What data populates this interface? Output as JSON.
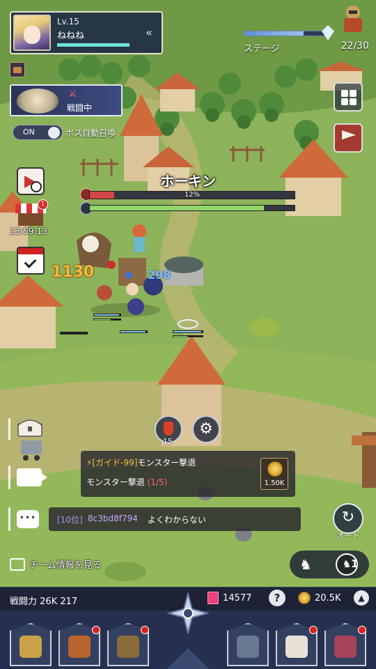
{
  "profile": {
    "level": "Lv.15",
    "name": "ねねね",
    "xp_fraction": 0.88
  },
  "battle": {
    "status": "戦闘中",
    "auto_summon_toggle": "ON",
    "auto_summon_label": "ボス自動召喚"
  },
  "shop": {
    "badge": "1",
    "timer": "23:59:13"
  },
  "stage": {
    "label": "ステージ",
    "count": "22/30",
    "progress_fraction": 0.73
  },
  "boss": {
    "name": "ホーキン",
    "hp_percent_text": "12%",
    "hp_fraction": 0.12,
    "time_fraction": 0.85
  },
  "damage": {
    "big": "1130",
    "small": "298"
  },
  "potion": {
    "count": "15"
  },
  "mission": {
    "guide_tag": "[ガイド-99]",
    "guide_text": "モンスター撃退",
    "task_text": "モンスター撃退",
    "task_progress": "(1/5)",
    "reward_value": "1.50K"
  },
  "chat": {
    "icon_text": "•••",
    "rank": "[10位]",
    "user": "8c3bd8f794",
    "message": "よくわからない"
  },
  "auto": {
    "label": "オート"
  },
  "team": {
    "link_label": "チーム情報を見る"
  },
  "formation": {
    "count": "1"
  },
  "stats": {
    "power_label": "戦闘力",
    "power_value": "26K 217",
    "gems": "14577",
    "gold": "20.5K",
    "help": "?",
    "up": "▲"
  },
  "icons": {
    "collapse": "collapse-icon",
    "swords": "crossed-swords-icon",
    "gear": "gear-icon",
    "auto": "auto-icon",
    "formation": "chess-piece-icon"
  },
  "colors": {
    "panel": "#1d2236",
    "hp_red": "#d54545",
    "time_green": "#8fd76a",
    "xp_teal": "#6ee2d4",
    "damage_gold": "#f5b839"
  }
}
